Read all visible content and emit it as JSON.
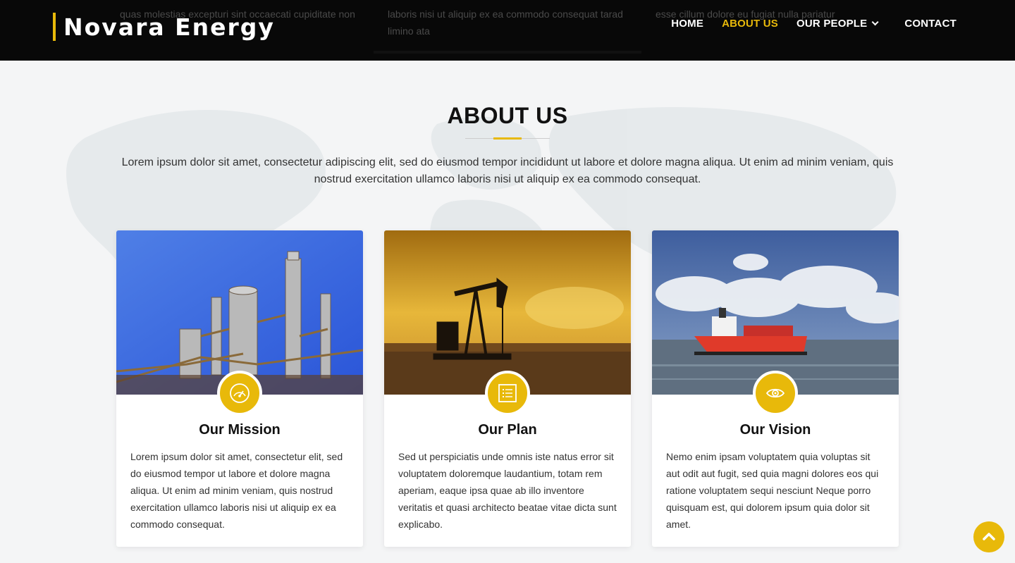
{
  "header": {
    "brand": "Novara Energy",
    "nav": [
      {
        "label": "HOME",
        "active": false
      },
      {
        "label": "ABOUT US",
        "active": true
      },
      {
        "label": "OUR PEOPLE",
        "active": false,
        "has_dropdown": true
      },
      {
        "label": "CONTACT",
        "active": false
      }
    ],
    "behind_text": [
      "quas molestias excepturi sint occaecati cupiditate non",
      "laboris nisi ut aliquip ex ea commodo consequat tarad",
      "limino ata",
      "esse cillum dolore eu fugiat nulla pariatur"
    ]
  },
  "about": {
    "title": "ABOUT US",
    "intro": "Lorem ipsum dolor sit amet, consectetur adipiscing elit, sed do eiusmod tempor incididunt ut labore et dolore magna aliqua. Ut enim ad minim veniam, quis nostrud exercitation ullamco laboris nisi ut aliquip ex ea commodo consequat."
  },
  "cards": [
    {
      "title": "Our Mission",
      "icon": "speedometer-icon",
      "image": "refinery-photo",
      "text": "Lorem ipsum dolor sit amet, consectetur elit, sed do eiusmod tempor ut labore et dolore magna aliqua. Ut enim ad minim veniam, quis nostrud exercitation ullamco laboris nisi ut aliquip ex ea commodo consequat."
    },
    {
      "title": "Our Plan",
      "icon": "list-icon",
      "image": "oil-pump-photo",
      "text": "Sed ut perspiciatis unde omnis iste natus error sit voluptatem doloremque laudantium, totam rem aperiam, eaque ipsa quae ab illo inventore veritatis et quasi architecto beatae vitae dicta sunt explicabo."
    },
    {
      "title": "Our Vision",
      "icon": "eye-icon",
      "image": "tanker-ship-photo",
      "text": "Nemo enim ipsam voluptatem quia voluptas sit aut odit aut fugit, sed quia magni dolores eos qui ratione voluptatem sequi nesciunt Neque porro quisquam est, qui dolorem ipsum quia dolor sit amet."
    }
  ],
  "colors": {
    "accent": "#e8b90a",
    "header_bg": "#000000",
    "page_bg": "#f4f5f6"
  },
  "scroll_top": {
    "icon": "chevron-up-icon"
  }
}
